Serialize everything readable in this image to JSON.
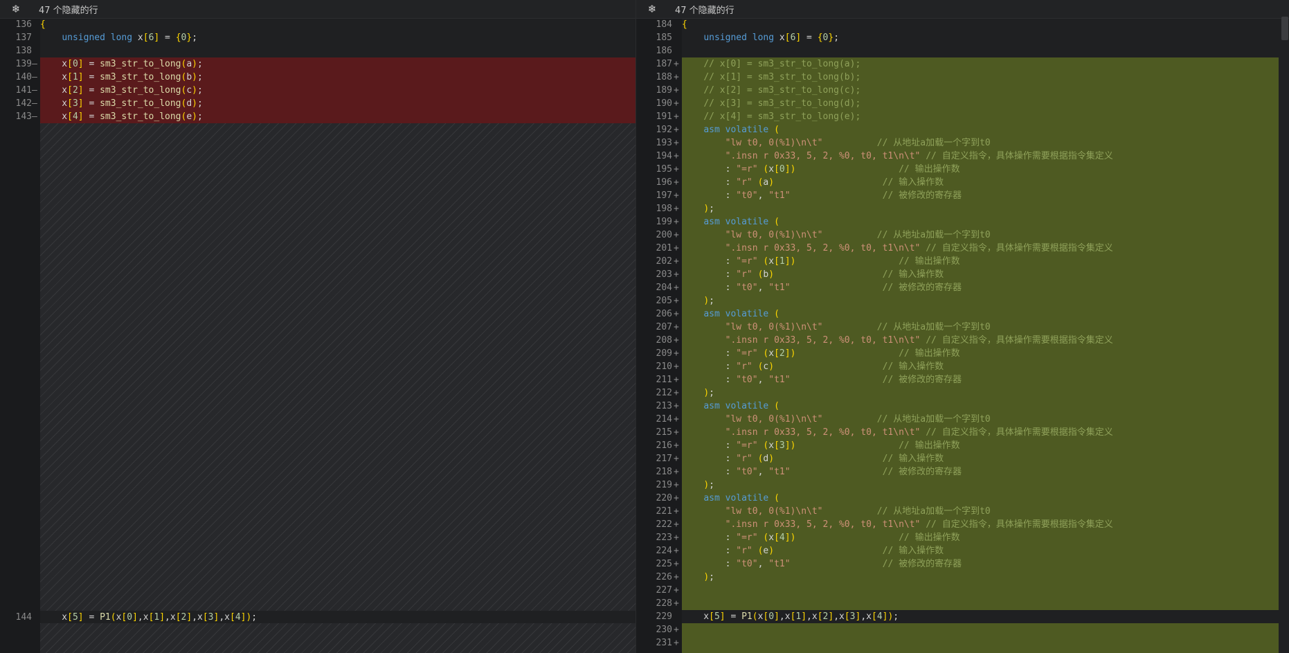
{
  "left": {
    "fold_label": "47 个隐藏的行",
    "lines": [
      {
        "n": "136",
        "m": "",
        "t": "{"
      },
      {
        "n": "137",
        "m": "",
        "t": "    unsigned long x[6] = {0};"
      },
      {
        "n": "138",
        "m": "",
        "t": ""
      },
      {
        "n": "139",
        "m": "—",
        "t": "    x[0] = sm3_str_to_long(a);"
      },
      {
        "n": "140",
        "m": "—",
        "t": "    x[1] = sm3_str_to_long(b);"
      },
      {
        "n": "141",
        "m": "—",
        "t": "    x[2] = sm3_str_to_long(c);"
      },
      {
        "n": "142",
        "m": "—",
        "t": "    x[3] = sm3_str_to_long(d);"
      },
      {
        "n": "143",
        "m": "—",
        "t": "    x[4] = sm3_str_to_long(e);"
      },
      {
        "n": "144",
        "m": "",
        "t": "    x[5] = P1(x[0],x[1],x[2],x[3],x[4]);"
      }
    ]
  },
  "right": {
    "fold_label": "47 个隐藏的行",
    "lines": [
      {
        "n": "184",
        "m": "",
        "t": "{"
      },
      {
        "n": "185",
        "m": "",
        "t": "    unsigned long x[6] = {0};"
      },
      {
        "n": "186",
        "m": "",
        "t": ""
      },
      {
        "n": "187",
        "m": "+",
        "t": "    // x[0] = sm3_str_to_long(a);"
      },
      {
        "n": "188",
        "m": "+",
        "t": "    // x[1] = sm3_str_to_long(b);"
      },
      {
        "n": "189",
        "m": "+",
        "t": "    // x[2] = sm3_str_to_long(c);"
      },
      {
        "n": "190",
        "m": "+",
        "t": "    // x[3] = sm3_str_to_long(d);"
      },
      {
        "n": "191",
        "m": "+",
        "t": "    // x[4] = sm3_str_to_long(e);"
      },
      {
        "n": "192",
        "m": "+",
        "t": "    asm volatile ("
      },
      {
        "n": "193",
        "m": "+",
        "t": "        \"lw t0, 0(%1)\\n\\t\"          // 从地址a加载一个字到t0"
      },
      {
        "n": "194",
        "m": "+",
        "t": "        \".insn r 0x33, 5, 2, %0, t0, t1\\n\\t\" // 自定义指令，具体操作需要根据指令集定义"
      },
      {
        "n": "195",
        "m": "+",
        "t": "        : \"=r\" (x[0])                   // 输出操作数"
      },
      {
        "n": "196",
        "m": "+",
        "t": "        : \"r\" (a)                    // 输入操作数"
      },
      {
        "n": "197",
        "m": "+",
        "t": "        : \"t0\", \"t1\"                 // 被修改的寄存器"
      },
      {
        "n": "198",
        "m": "+",
        "t": "    );"
      },
      {
        "n": "199",
        "m": "+",
        "t": "    asm volatile ("
      },
      {
        "n": "200",
        "m": "+",
        "t": "        \"lw t0, 0(%1)\\n\\t\"          // 从地址a加载一个字到t0"
      },
      {
        "n": "201",
        "m": "+",
        "t": "        \".insn r 0x33, 5, 2, %0, t0, t1\\n\\t\" // 自定义指令，具体操作需要根据指令集定义"
      },
      {
        "n": "202",
        "m": "+",
        "t": "        : \"=r\" (x[1])                   // 输出操作数"
      },
      {
        "n": "203",
        "m": "+",
        "t": "        : \"r\" (b)                    // 输入操作数"
      },
      {
        "n": "204",
        "m": "+",
        "t": "        : \"t0\", \"t1\"                 // 被修改的寄存器"
      },
      {
        "n": "205",
        "m": "+",
        "t": "    );"
      },
      {
        "n": "206",
        "m": "+",
        "t": "    asm volatile ("
      },
      {
        "n": "207",
        "m": "+",
        "t": "        \"lw t0, 0(%1)\\n\\t\"          // 从地址a加载一个字到t0"
      },
      {
        "n": "208",
        "m": "+",
        "t": "        \".insn r 0x33, 5, 2, %0, t0, t1\\n\\t\" // 自定义指令，具体操作需要根据指令集定义"
      },
      {
        "n": "209",
        "m": "+",
        "t": "        : \"=r\" (x[2])                   // 输出操作数"
      },
      {
        "n": "210",
        "m": "+",
        "t": "        : \"r\" (c)                    // 输入操作数"
      },
      {
        "n": "211",
        "m": "+",
        "t": "        : \"t0\", \"t1\"                 // 被修改的寄存器"
      },
      {
        "n": "212",
        "m": "+",
        "t": "    );"
      },
      {
        "n": "213",
        "m": "+",
        "t": "    asm volatile ("
      },
      {
        "n": "214",
        "m": "+",
        "t": "        \"lw t0, 0(%1)\\n\\t\"          // 从地址a加载一个字到t0"
      },
      {
        "n": "215",
        "m": "+",
        "t": "        \".insn r 0x33, 5, 2, %0, t0, t1\\n\\t\" // 自定义指令，具体操作需要根据指令集定义"
      },
      {
        "n": "216",
        "m": "+",
        "t": "        : \"=r\" (x[3])                   // 输出操作数"
      },
      {
        "n": "217",
        "m": "+",
        "t": "        : \"r\" (d)                    // 输入操作数"
      },
      {
        "n": "218",
        "m": "+",
        "t": "        : \"t0\", \"t1\"                 // 被修改的寄存器"
      },
      {
        "n": "219",
        "m": "+",
        "t": "    );"
      },
      {
        "n": "220",
        "m": "+",
        "t": "    asm volatile ("
      },
      {
        "n": "221",
        "m": "+",
        "t": "        \"lw t0, 0(%1)\\n\\t\"          // 从地址a加载一个字到t0"
      },
      {
        "n": "222",
        "m": "+",
        "t": "        \".insn r 0x33, 5, 2, %0, t0, t1\\n\\t\" // 自定义指令，具体操作需要根据指令集定义"
      },
      {
        "n": "223",
        "m": "+",
        "t": "        : \"=r\" (x[4])                   // 输出操作数"
      },
      {
        "n": "224",
        "m": "+",
        "t": "        : \"r\" (e)                    // 输入操作数"
      },
      {
        "n": "225",
        "m": "+",
        "t": "        : \"t0\", \"t1\"                 // 被修改的寄存器"
      },
      {
        "n": "226",
        "m": "+",
        "t": "    );"
      },
      {
        "n": "227",
        "m": "+",
        "t": ""
      },
      {
        "n": "228",
        "m": "+",
        "t": ""
      },
      {
        "n": "229",
        "m": "",
        "t": "    x[5] = P1(x[0],x[1],x[2],x[3],x[4]);"
      },
      {
        "n": "230",
        "m": "+",
        "t": ""
      },
      {
        "n": "231",
        "m": "+",
        "t": ""
      }
    ]
  },
  "colors": {
    "deleted": "#5a1a1c",
    "added": "#4e5a22",
    "hatch": "#27282b"
  },
  "icons": {
    "fold": "snowflake-icon"
  }
}
